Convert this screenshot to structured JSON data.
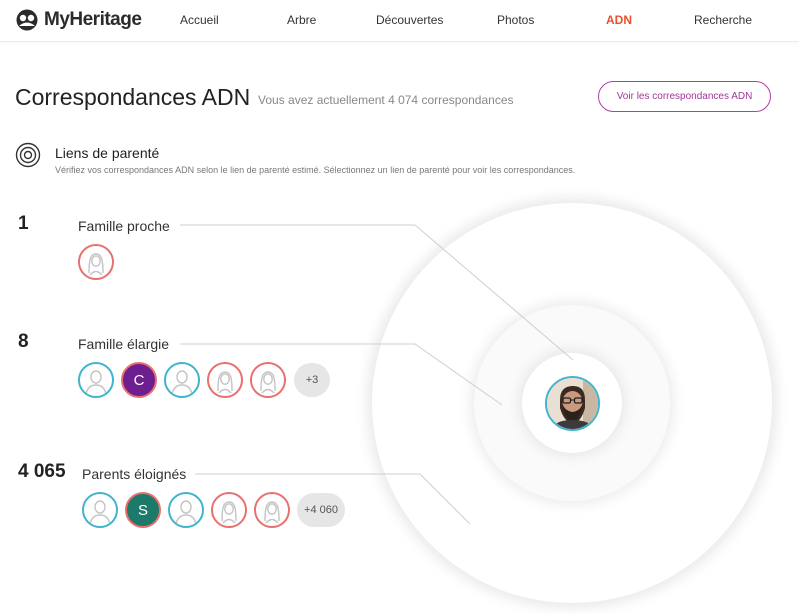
{
  "brand": {
    "name": "MyHeritage"
  },
  "nav": {
    "items": [
      {
        "label": "Accueil"
      },
      {
        "label": "Arbre"
      },
      {
        "label": "Découvertes"
      },
      {
        "label": "Photos"
      },
      {
        "label": "ADN",
        "active": true
      },
      {
        "label": "Recherche"
      }
    ]
  },
  "header": {
    "title": "Correspondances ADN",
    "subtitle": "Vous avez actuellement 4 074 correspondances",
    "button_label": "Voir les correspondances ADN"
  },
  "section": {
    "icon": "target-icon",
    "title": "Liens de parenté",
    "description": "Vérifiez vos correspondances ADN selon le lien de parenté estimé. Sélectionnez un lien de parenté pour voir les correspondances."
  },
  "groups": [
    {
      "count": "1",
      "label": "Famille proche",
      "avatars": [
        {
          "kind": "female"
        }
      ],
      "more": ""
    },
    {
      "count": "8",
      "label": "Famille élargie",
      "avatars": [
        {
          "kind": "male"
        },
        {
          "kind": "letter",
          "letter": "C",
          "color": "#6e1f8f"
        },
        {
          "kind": "male"
        },
        {
          "kind": "female"
        },
        {
          "kind": "female"
        }
      ],
      "more": "+3"
    },
    {
      "count": "4 065",
      "label": "Parents éloignés",
      "avatars": [
        {
          "kind": "male"
        },
        {
          "kind": "letter",
          "letter": "S",
          "color": "#1d7a6a"
        },
        {
          "kind": "male"
        },
        {
          "kind": "female"
        },
        {
          "kind": "female"
        }
      ],
      "more": "+4 060"
    }
  ],
  "colors": {
    "accent": "#e7512f",
    "button": "#a3359b",
    "male_ring": "#3fb4cd",
    "female_ring": "#ea6f6f"
  }
}
